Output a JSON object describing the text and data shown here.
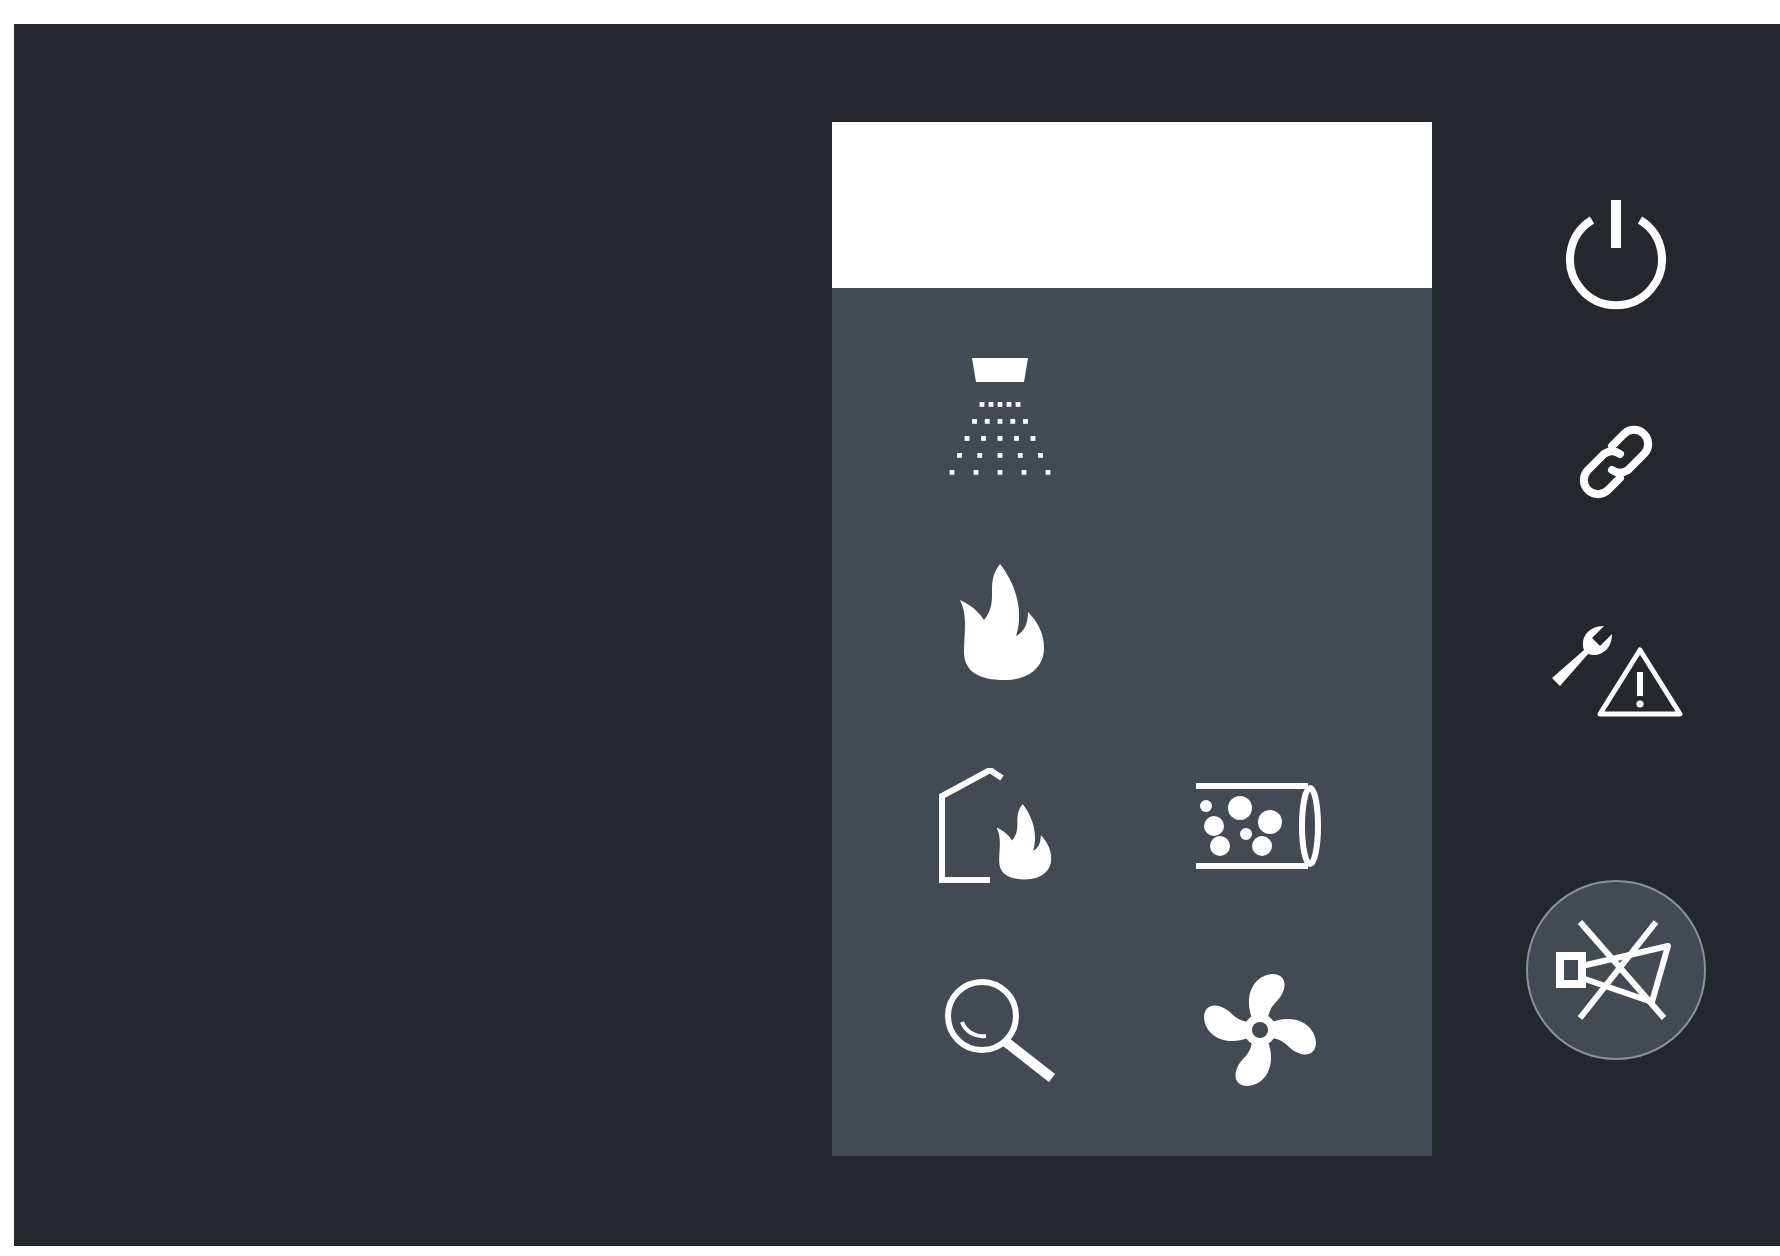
{
  "panel": {
    "cells": [
      {
        "kind": "sprinkler"
      },
      {
        "kind": "empty"
      },
      {
        "kind": "fire"
      },
      {
        "kind": "empty"
      },
      {
        "kind": "building_fire"
      },
      {
        "kind": "pipe_bubbles"
      },
      {
        "kind": "search"
      },
      {
        "kind": "fan"
      }
    ]
  },
  "side_buttons": [
    {
      "kind": "power",
      "active": false
    },
    {
      "kind": "link",
      "active": false
    },
    {
      "kind": "maintenance_warning",
      "active": false
    },
    {
      "kind": "horn_muted",
      "active": true
    }
  ]
}
